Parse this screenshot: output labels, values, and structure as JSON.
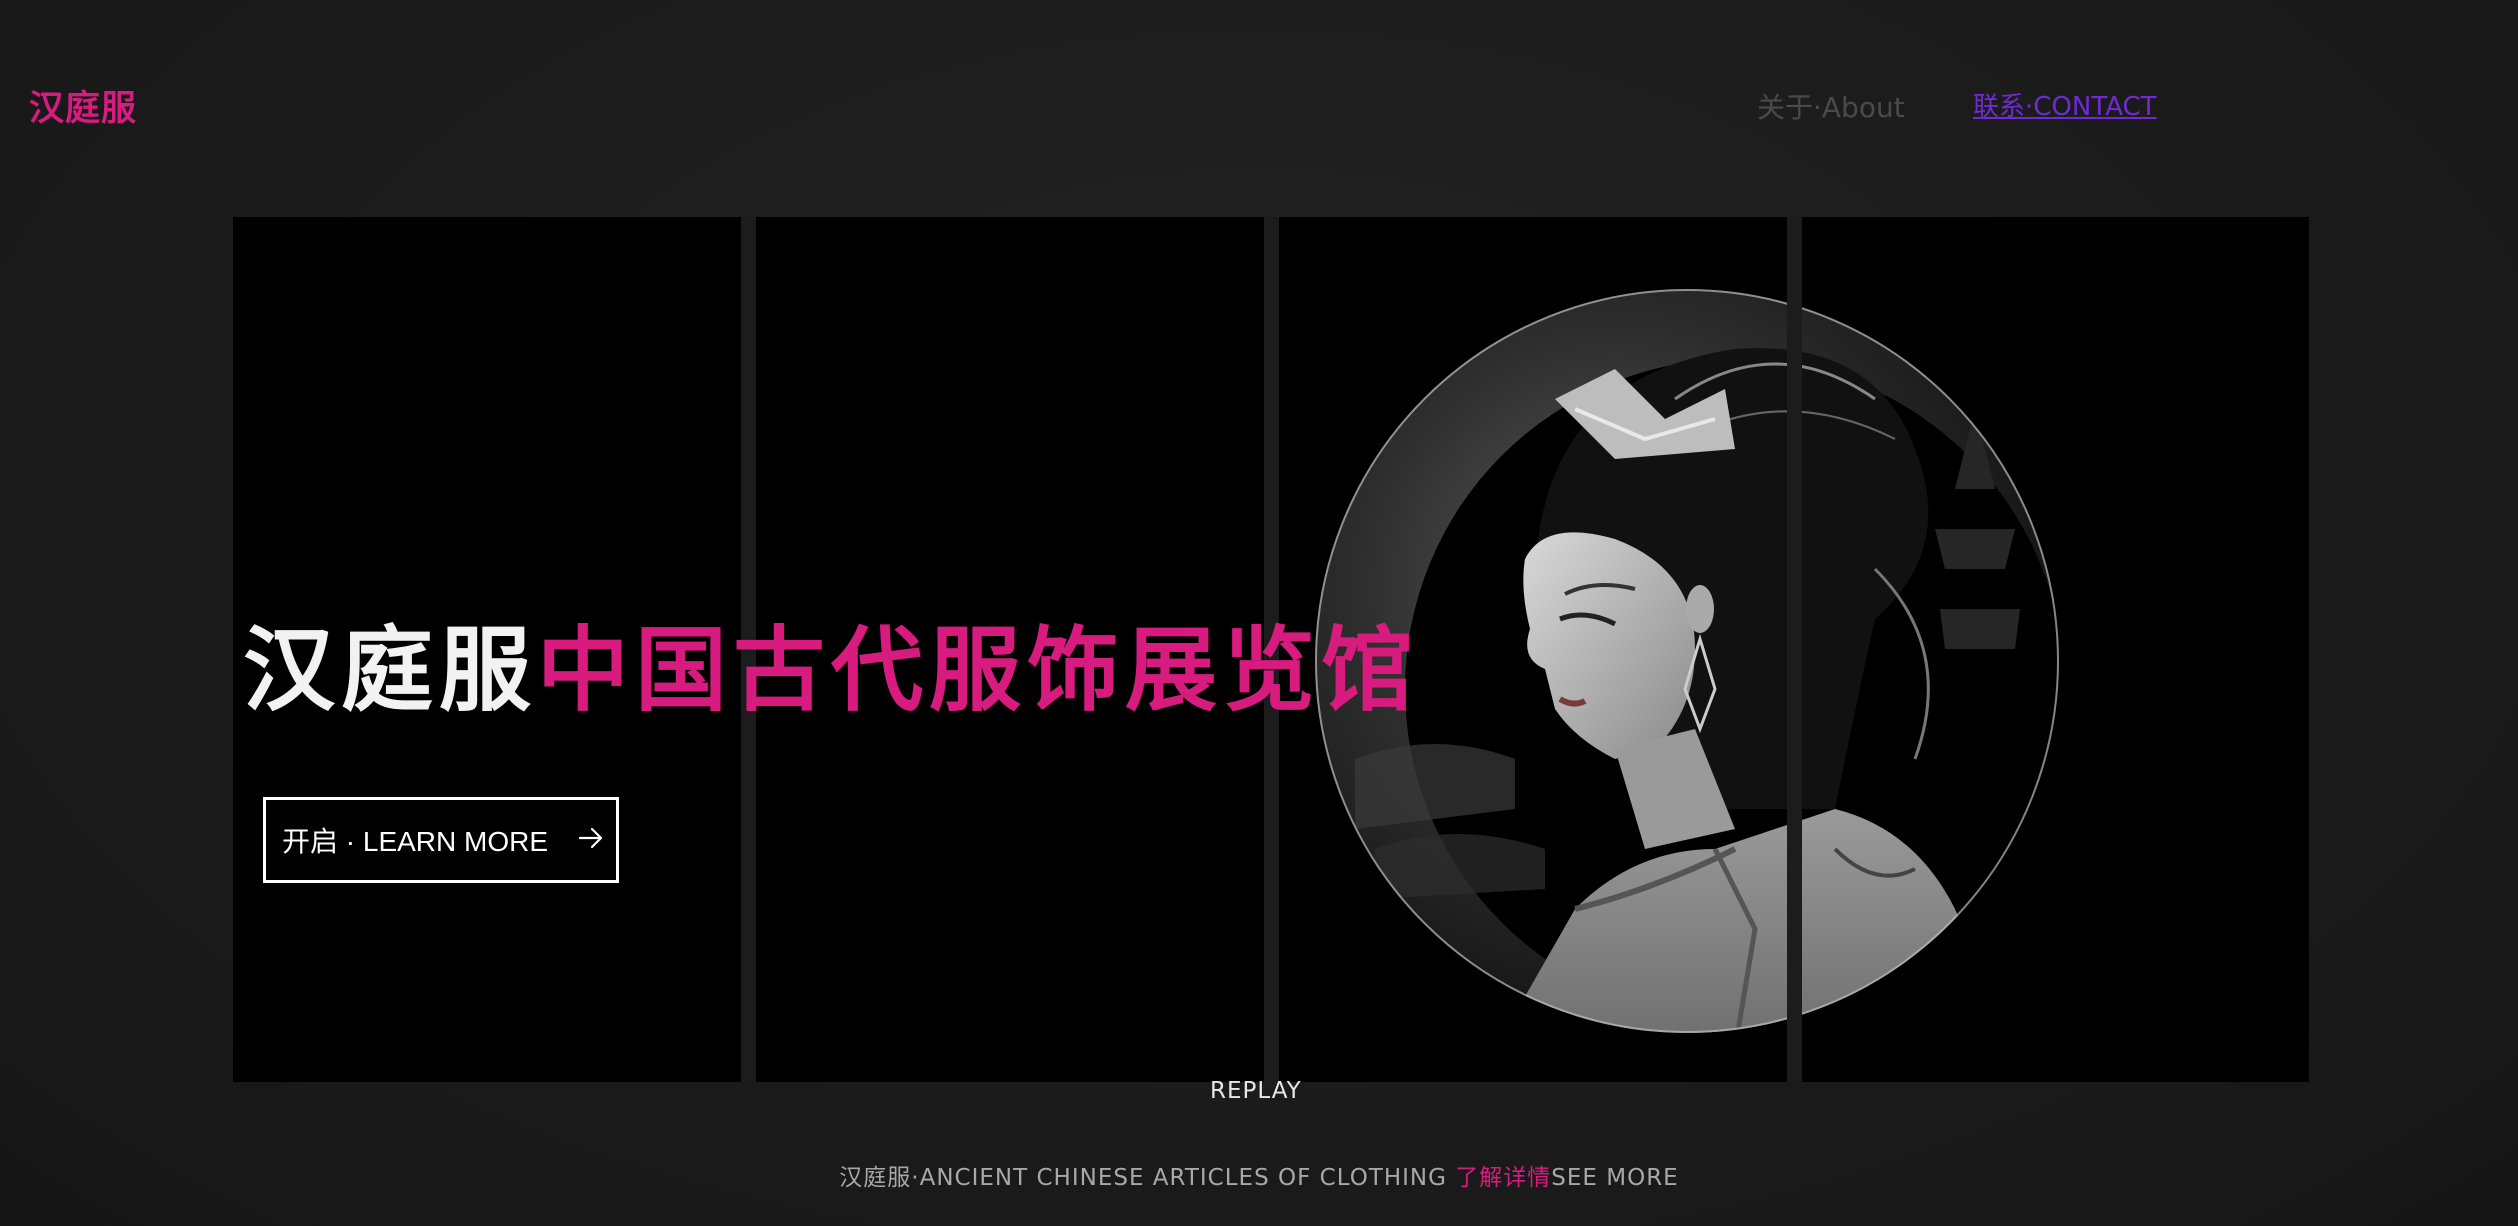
{
  "header": {
    "logo": "汉庭服",
    "nav": {
      "about": "关于·About",
      "contact": "联系·CONTACT"
    }
  },
  "hero": {
    "title_white": "汉庭服",
    "title_pink": "中国古代服饰展览馆",
    "button_label": "开启 · LEARN MORE",
    "button_icon": "arrow-right-icon",
    "portrait_icon": "woman-portrait-illustration"
  },
  "replay_label": "REPLAY",
  "footer": {
    "prefix": "汉庭服·ANCIENT CHINESE ARTICLES OF CLOTHING ",
    "link_cn": "了解详情",
    "link_en": "SEE MORE"
  },
  "colors": {
    "accent_pink": "#d81b7f",
    "contact_link": "#6f2ad3",
    "background": "#1b1b1b",
    "panel": "#000000"
  }
}
